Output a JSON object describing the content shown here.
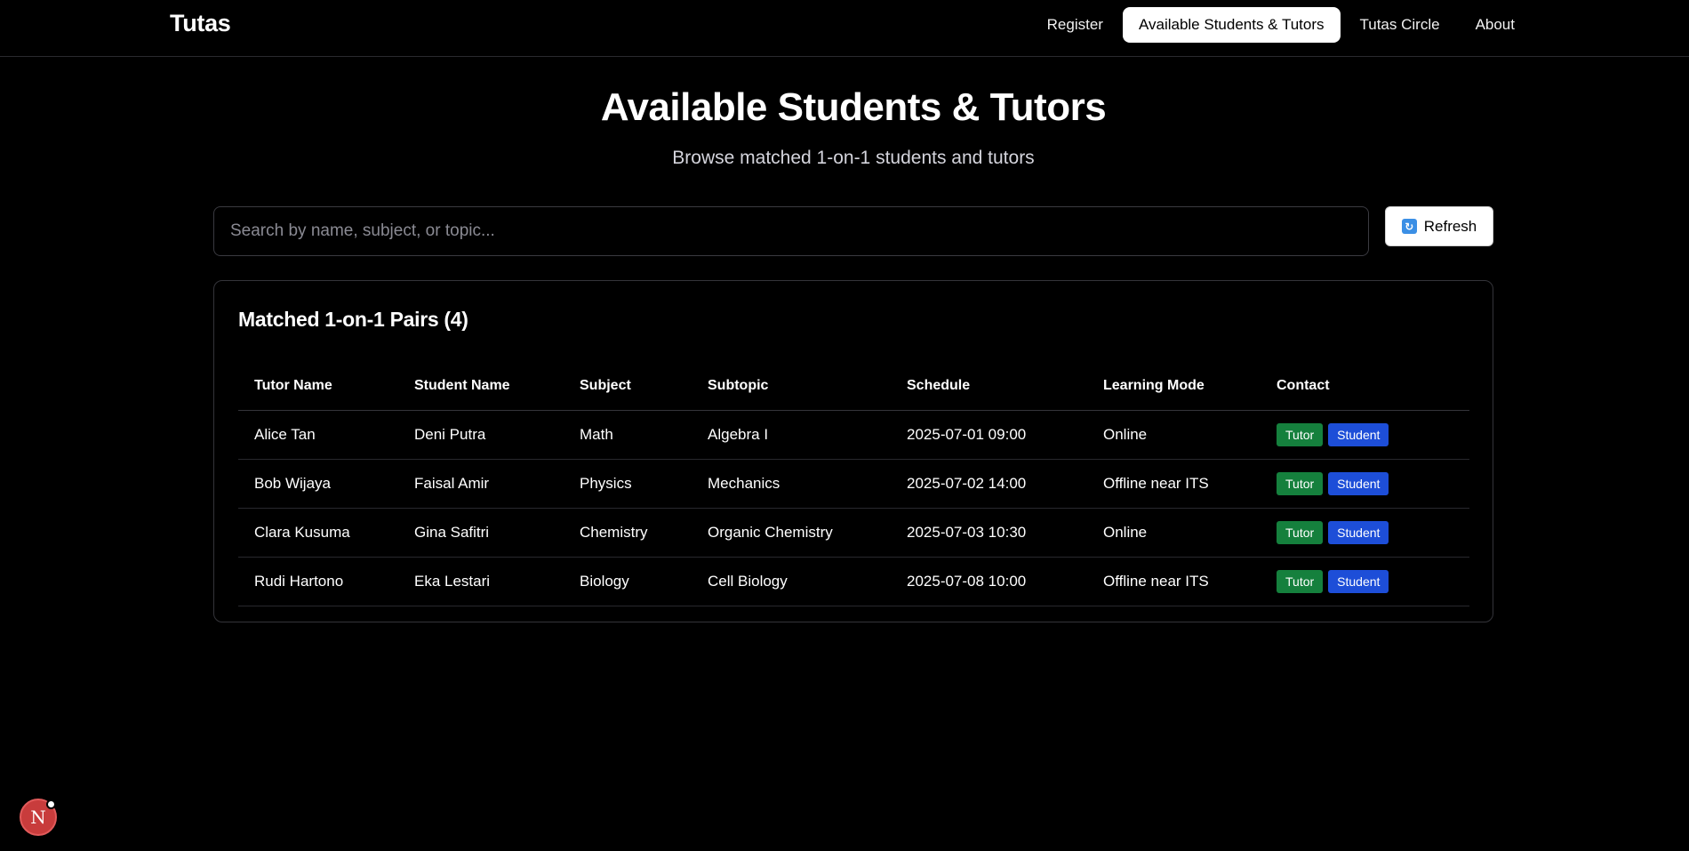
{
  "nav": {
    "brand": "Tutas",
    "links": [
      {
        "label": "Register",
        "active": false
      },
      {
        "label": "Available Students & Tutors",
        "active": true
      },
      {
        "label": "Tutas Circle",
        "active": false
      },
      {
        "label": "About",
        "active": false
      }
    ]
  },
  "header": {
    "title": "Available Students & Tutors",
    "subtitle": "Browse matched 1-on-1 students and tutors"
  },
  "search": {
    "placeholder": "Search by name, subject, or topic...",
    "value": ""
  },
  "refresh": {
    "label": "Refresh",
    "icon": "refresh-icon"
  },
  "card": {
    "title": "Matched 1-on-1 Pairs (4)",
    "columns": [
      "Tutor Name",
      "Student Name",
      "Subject",
      "Subtopic",
      "Schedule",
      "Learning Mode",
      "Contact"
    ],
    "rows": [
      {
        "tutor": "Alice Tan",
        "student": "Deni Putra",
        "subject": "Math",
        "subtopic": "Algebra I",
        "schedule": "2025-07-01 09:00",
        "mode": "Online",
        "contact_tutor": "Tutor",
        "contact_student": "Student"
      },
      {
        "tutor": "Bob Wijaya",
        "student": "Faisal Amir",
        "subject": "Physics",
        "subtopic": "Mechanics",
        "schedule": "2025-07-02 14:00",
        "mode": "Offline near ITS",
        "contact_tutor": "Tutor",
        "contact_student": "Student"
      },
      {
        "tutor": "Clara Kusuma",
        "student": "Gina Safitri",
        "subject": "Chemistry",
        "subtopic": "Organic Chemistry",
        "schedule": "2025-07-03 10:30",
        "mode": "Online",
        "contact_tutor": "Tutor",
        "contact_student": "Student"
      },
      {
        "tutor": "Rudi Hartono",
        "student": "Eka Lestari",
        "subject": "Biology",
        "subtopic": "Cell Biology",
        "schedule": "2025-07-08 10:00",
        "mode": "Offline near ITS",
        "contact_tutor": "Tutor",
        "contact_student": "Student"
      }
    ]
  },
  "colors": {
    "background": "#000000",
    "tutor_badge": "#15803d",
    "student_badge": "#1d4ed8",
    "dev_indicator": "#c83c3c"
  },
  "dev_indicator": {
    "letter": "N"
  }
}
